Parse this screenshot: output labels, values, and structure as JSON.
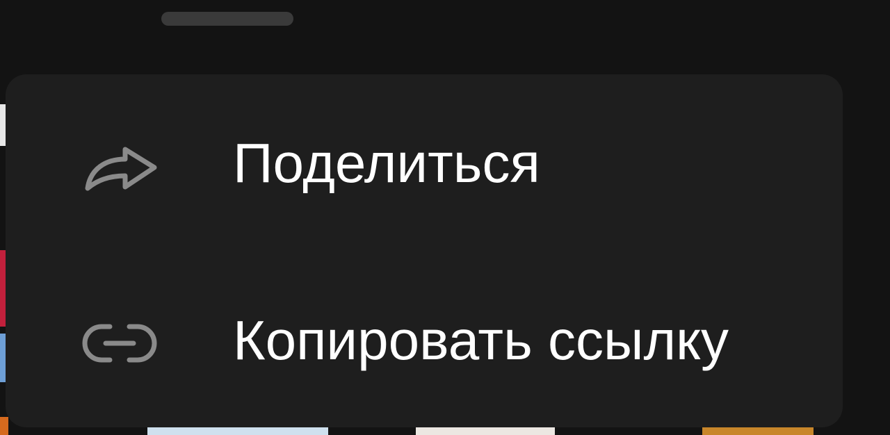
{
  "menu": {
    "items": [
      {
        "label": "Поделиться",
        "icon": "share-icon"
      },
      {
        "label": "Копировать ссылку",
        "icon": "link-icon"
      }
    ]
  },
  "colors": {
    "sheet_background": "#131313",
    "menu_background": "#1e1e1e",
    "label_text": "#ffffff",
    "icon_stroke": "#8a8a8a",
    "drag_handle": "#3a3a3a"
  }
}
